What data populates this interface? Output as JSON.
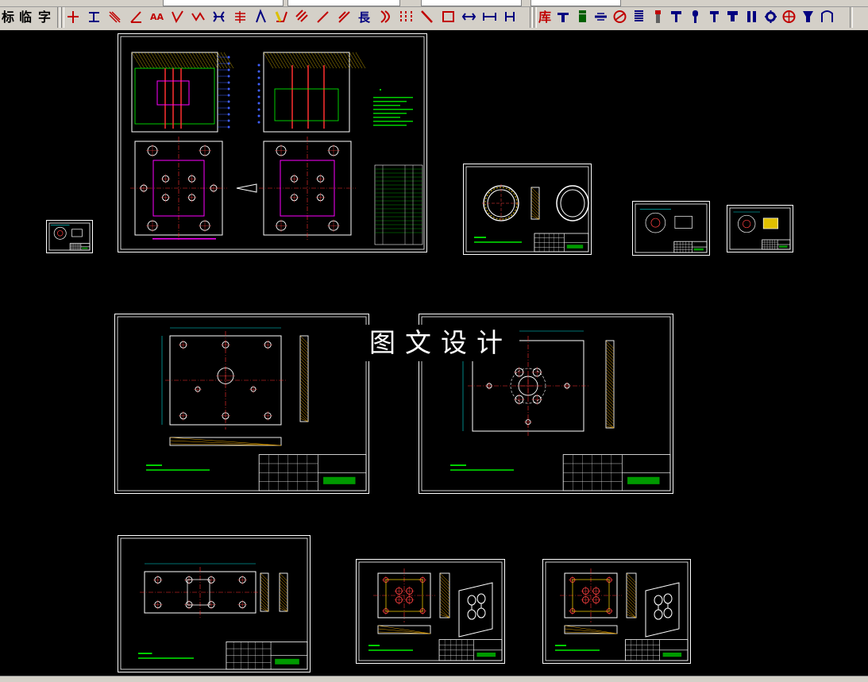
{
  "toolbar": {
    "labels": [
      "标",
      "临",
      "字"
    ],
    "icons": [
      {
        "name": "cross-line-icon",
        "color": "#c00000"
      },
      {
        "name": "horizontal-dim-icon",
        "color": "#000080"
      },
      {
        "name": "hatch-line-icon",
        "color": "#c00000"
      },
      {
        "name": "angle-dim-icon",
        "color": "#c00000"
      },
      {
        "name": "text-aa-icon",
        "color": "#c00000"
      },
      {
        "name": "leader-icon",
        "color": "#c00000"
      },
      {
        "name": "zigzag-icon",
        "color": "#c00000"
      },
      {
        "name": "bracket-icon",
        "color": "#000080"
      },
      {
        "name": "multi-line-icon",
        "color": "#c00000"
      },
      {
        "name": "slant-icon",
        "color": "#000080"
      },
      {
        "name": "chamfer-icon",
        "color": "#c00000"
      },
      {
        "name": "parallel-hatch-icon",
        "color": "#c00000"
      },
      {
        "name": "diagonal-icon",
        "color": "#c00000"
      },
      {
        "name": "diagonal-line-icon",
        "color": "#c00000"
      },
      {
        "name": "length-label-icon",
        "color": "#000080"
      },
      {
        "name": "arc-icon",
        "color": "#c00000"
      },
      {
        "name": "centerline-icon",
        "color": "#c00000"
      },
      {
        "name": "slash-icon",
        "color": "#c00000"
      },
      {
        "name": "rectangle-icon",
        "color": "#c00000"
      },
      {
        "name": "extend-icon",
        "color": "#000080"
      },
      {
        "name": "stretch-icon",
        "color": "#000080"
      },
      {
        "name": "bar-dim-icon",
        "color": "#000080"
      }
    ],
    "lib_label": "库",
    "lib_icons": [
      {
        "name": "bolt-icon",
        "color": "#000080"
      },
      {
        "name": "pin-icon",
        "color": "#006000"
      },
      {
        "name": "washer-icon",
        "color": "#000080"
      },
      {
        "name": "bearing-icon",
        "color": "#c00000"
      },
      {
        "name": "spring-icon",
        "color": "#000080"
      },
      {
        "name": "screw-icon",
        "color": "#c00000"
      },
      {
        "name": "t-bolt-icon",
        "color": "#000080"
      },
      {
        "name": "rivet-icon",
        "color": "#000080"
      },
      {
        "name": "nail-icon",
        "color": "#000080"
      },
      {
        "name": "stud-icon",
        "color": "#000080"
      },
      {
        "name": "key-icon",
        "color": "#000080"
      },
      {
        "name": "gear-icon",
        "color": "#000080"
      },
      {
        "name": "target-icon",
        "color": "#c00000"
      },
      {
        "name": "cup-icon",
        "color": "#000080"
      },
      {
        "name": "clamp-icon",
        "color": "#000080"
      }
    ]
  },
  "watermark": {
    "text": "图文设计"
  },
  "drawings": [
    {
      "name": "assembly-drawing"
    },
    {
      "name": "small-part-sheet"
    },
    {
      "name": "ring-part-sheet"
    },
    {
      "name": "pin-part-sheet"
    },
    {
      "name": "insert-part-sheet"
    },
    {
      "name": "plate-drawing-left"
    },
    {
      "name": "plate-drawing-right"
    },
    {
      "name": "base-plate-drawing"
    },
    {
      "name": "cavity-plate-drawing"
    },
    {
      "name": "core-plate-drawing"
    }
  ]
}
